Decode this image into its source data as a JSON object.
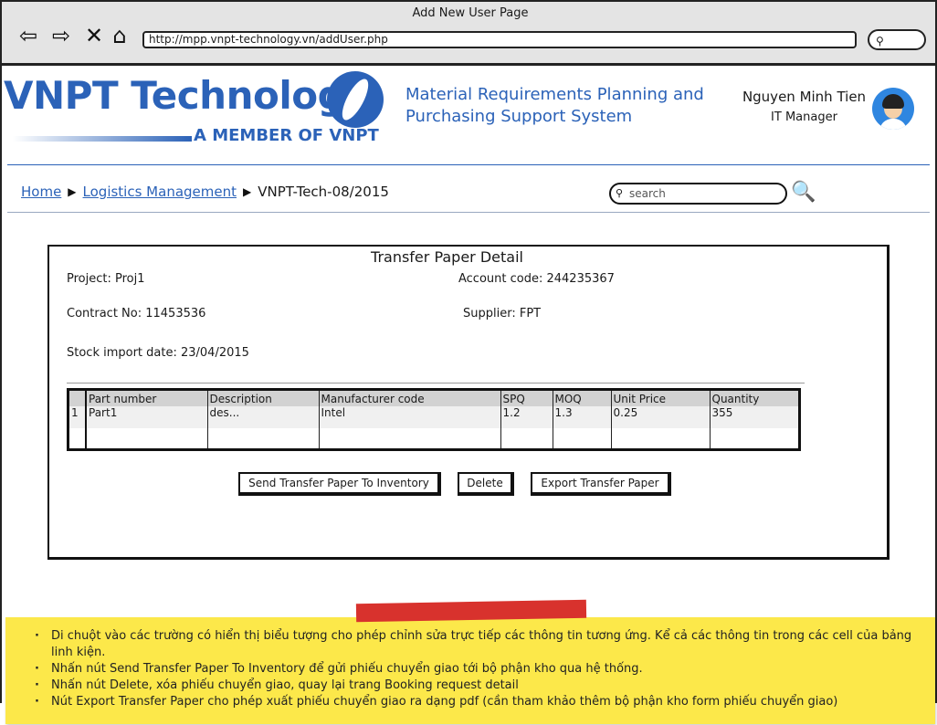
{
  "browser": {
    "window_title": "Add New User Page",
    "url": "http://mpp.vnpt-technology.vn/addUser.php"
  },
  "header": {
    "logo_text": "VNPT Technology",
    "logo_tagline": "A MEMBER OF VNPT",
    "system_name": "Material Requirements Planning and Purchasing Support System",
    "user_name": "Nguyen Minh Tien",
    "user_role": "IT Manager"
  },
  "breadcrumb": {
    "items": [
      "Home",
      "Logistics Management"
    ],
    "current": "VNPT-Tech-08/2015"
  },
  "search": {
    "placeholder": "search"
  },
  "panel": {
    "title": "Transfer Paper Detail",
    "project": "Project: Proj1",
    "account_code": "Account code: 244235367",
    "contract_no": "Contract No: 11453536",
    "supplier": "Supplier: FPT",
    "stock_import_date": "Stock import date: 23/04/2015"
  },
  "table": {
    "columns": [
      "Part number",
      "Description",
      "Manufacturer code",
      "SPQ",
      "MOQ",
      "Unit Price",
      "Quantity"
    ],
    "rows": [
      {
        "index": "1",
        "part_number": "Part1",
        "description": "des...",
        "manufacturer_code": "Intel",
        "spq": "1.2",
        "moq": "1.3",
        "unit_price": "0.25",
        "quantity": "355"
      }
    ]
  },
  "buttons": {
    "send": "Send Transfer Paper To Inventory",
    "delete": "Delete",
    "export": "Export Transfer Paper"
  },
  "note": {
    "items": [
      "Di chuột vào các trường có hiển thị biểu tượng cho phép chỉnh sửa trực tiếp các thông tin tương ứng. Kể cả các thông tin trong các cell của bảng linh kiện.",
      "Nhấn nút Send Transfer Paper To Inventory để gửi phiếu chuyển giao tới bộ phận kho qua hệ thống.",
      "Nhấn nút Delete, xóa phiếu chuyển giao, quay lại trang Booking request detail",
      "Nút Export Transfer Paper cho phép xuất phiếu chuyển giao ra dạng pdf (cần tham khảo thêm bộ phận kho form phiếu chuyển giao)"
    ]
  },
  "colors": {
    "brand_blue": "#2b62b8",
    "note_yellow": "#fce84a",
    "note_tape": "#d8322d"
  }
}
